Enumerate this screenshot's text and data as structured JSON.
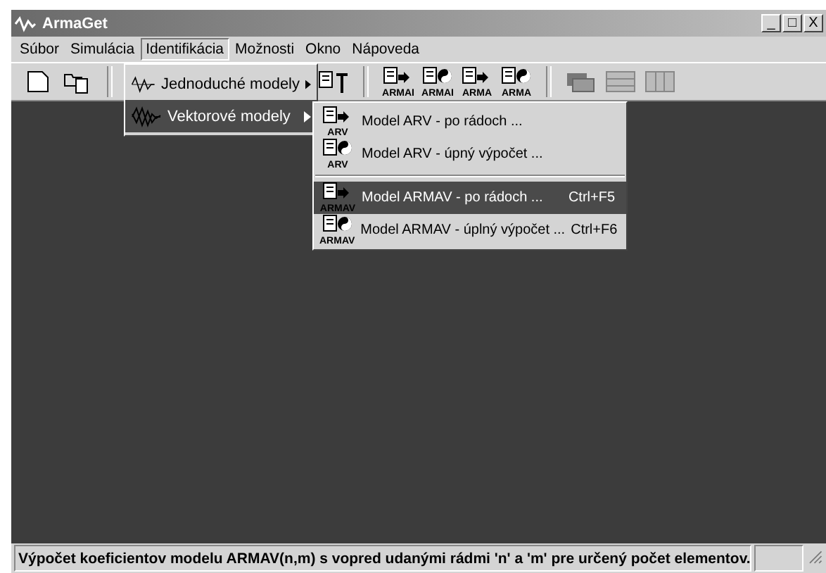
{
  "window": {
    "title": "ArmaGet",
    "controls": [
      "_",
      "□",
      "X"
    ]
  },
  "menu": [
    {
      "label": "Súbor",
      "selected": false
    },
    {
      "label": "Simulácia",
      "selected": false
    },
    {
      "label": "Identifikácia",
      "selected": true
    },
    {
      "label": "Možnosti",
      "selected": false
    },
    {
      "label": "Okno",
      "selected": false
    },
    {
      "label": "Nápoveda",
      "selected": false
    }
  ],
  "toolbar": [
    {
      "kind": "new"
    },
    {
      "kind": "open"
    },
    {
      "kind": "sep"
    },
    {
      "kind": "text-doc"
    },
    {
      "kind": "sep"
    },
    {
      "kind": "doc-arrow",
      "caption": "ARMAI"
    },
    {
      "kind": "doc-yinyang",
      "caption": "ARMAI"
    },
    {
      "kind": "doc-arrow",
      "caption": "ARMA"
    },
    {
      "kind": "doc-yinyang",
      "caption": "ARMA"
    },
    {
      "kind": "sep"
    },
    {
      "kind": "cascade"
    },
    {
      "kind": "rows"
    },
    {
      "kind": "columns"
    }
  ],
  "dropdown": [
    {
      "label": "Jednoduché modely",
      "kind": "wave",
      "selected": false
    },
    {
      "label": "Vektorové modely",
      "kind": "multiwave",
      "selected": true
    }
  ],
  "submenu": [
    {
      "kind": "doc-arrow",
      "caption": "ARV",
      "label": "Model ARV - po rádoch ...",
      "selected": false
    },
    {
      "kind": "doc-yinyang",
      "caption": "ARV",
      "label": "Model ARV - úpný výpočet ...",
      "selected": false
    },
    {
      "kind": "sep"
    },
    {
      "kind": "doc-arrow",
      "caption": "ARMAV",
      "label": "Model ARMAV - po rádoch ...",
      "shortcut": "Ctrl+F5",
      "selected": true
    },
    {
      "kind": "doc-yinyang",
      "caption": "ARMAV",
      "label": "Model ARMAV - úplný výpočet ...",
      "shortcut": "Ctrl+F6",
      "selected": false
    }
  ],
  "status_bar": {
    "text": "Výpočet koeficientov modelu ARMAV(n,m) s vopred udanými rádmi 'n' a 'm' pre určený počet elementov."
  }
}
